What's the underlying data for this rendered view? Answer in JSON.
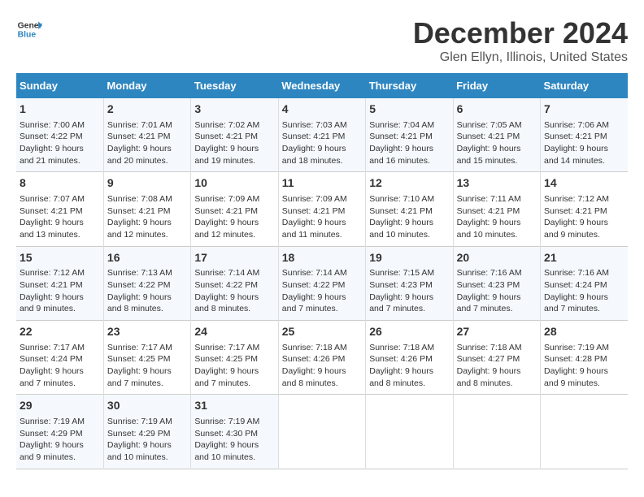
{
  "header": {
    "logo_line1": "General",
    "logo_line2": "Blue",
    "title": "December 2024",
    "subtitle": "Glen Ellyn, Illinois, United States"
  },
  "days_of_week": [
    "Sunday",
    "Monday",
    "Tuesday",
    "Wednesday",
    "Thursday",
    "Friday",
    "Saturday"
  ],
  "weeks": [
    [
      {
        "day": "1",
        "info": "Sunrise: 7:00 AM\nSunset: 4:22 PM\nDaylight: 9 hours\nand 21 minutes."
      },
      {
        "day": "2",
        "info": "Sunrise: 7:01 AM\nSunset: 4:21 PM\nDaylight: 9 hours\nand 20 minutes."
      },
      {
        "day": "3",
        "info": "Sunrise: 7:02 AM\nSunset: 4:21 PM\nDaylight: 9 hours\nand 19 minutes."
      },
      {
        "day": "4",
        "info": "Sunrise: 7:03 AM\nSunset: 4:21 PM\nDaylight: 9 hours\nand 18 minutes."
      },
      {
        "day": "5",
        "info": "Sunrise: 7:04 AM\nSunset: 4:21 PM\nDaylight: 9 hours\nand 16 minutes."
      },
      {
        "day": "6",
        "info": "Sunrise: 7:05 AM\nSunset: 4:21 PM\nDaylight: 9 hours\nand 15 minutes."
      },
      {
        "day": "7",
        "info": "Sunrise: 7:06 AM\nSunset: 4:21 PM\nDaylight: 9 hours\nand 14 minutes."
      }
    ],
    [
      {
        "day": "8",
        "info": "Sunrise: 7:07 AM\nSunset: 4:21 PM\nDaylight: 9 hours\nand 13 minutes."
      },
      {
        "day": "9",
        "info": "Sunrise: 7:08 AM\nSunset: 4:21 PM\nDaylight: 9 hours\nand 12 minutes."
      },
      {
        "day": "10",
        "info": "Sunrise: 7:09 AM\nSunset: 4:21 PM\nDaylight: 9 hours\nand 12 minutes."
      },
      {
        "day": "11",
        "info": "Sunrise: 7:09 AM\nSunset: 4:21 PM\nDaylight: 9 hours\nand 11 minutes."
      },
      {
        "day": "12",
        "info": "Sunrise: 7:10 AM\nSunset: 4:21 PM\nDaylight: 9 hours\nand 10 minutes."
      },
      {
        "day": "13",
        "info": "Sunrise: 7:11 AM\nSunset: 4:21 PM\nDaylight: 9 hours\nand 10 minutes."
      },
      {
        "day": "14",
        "info": "Sunrise: 7:12 AM\nSunset: 4:21 PM\nDaylight: 9 hours\nand 9 minutes."
      }
    ],
    [
      {
        "day": "15",
        "info": "Sunrise: 7:12 AM\nSunset: 4:21 PM\nDaylight: 9 hours\nand 9 minutes."
      },
      {
        "day": "16",
        "info": "Sunrise: 7:13 AM\nSunset: 4:22 PM\nDaylight: 9 hours\nand 8 minutes."
      },
      {
        "day": "17",
        "info": "Sunrise: 7:14 AM\nSunset: 4:22 PM\nDaylight: 9 hours\nand 8 minutes."
      },
      {
        "day": "18",
        "info": "Sunrise: 7:14 AM\nSunset: 4:22 PM\nDaylight: 9 hours\nand 7 minutes."
      },
      {
        "day": "19",
        "info": "Sunrise: 7:15 AM\nSunset: 4:23 PM\nDaylight: 9 hours\nand 7 minutes."
      },
      {
        "day": "20",
        "info": "Sunrise: 7:16 AM\nSunset: 4:23 PM\nDaylight: 9 hours\nand 7 minutes."
      },
      {
        "day": "21",
        "info": "Sunrise: 7:16 AM\nSunset: 4:24 PM\nDaylight: 9 hours\nand 7 minutes."
      }
    ],
    [
      {
        "day": "22",
        "info": "Sunrise: 7:17 AM\nSunset: 4:24 PM\nDaylight: 9 hours\nand 7 minutes."
      },
      {
        "day": "23",
        "info": "Sunrise: 7:17 AM\nSunset: 4:25 PM\nDaylight: 9 hours\nand 7 minutes."
      },
      {
        "day": "24",
        "info": "Sunrise: 7:17 AM\nSunset: 4:25 PM\nDaylight: 9 hours\nand 7 minutes."
      },
      {
        "day": "25",
        "info": "Sunrise: 7:18 AM\nSunset: 4:26 PM\nDaylight: 9 hours\nand 8 minutes."
      },
      {
        "day": "26",
        "info": "Sunrise: 7:18 AM\nSunset: 4:26 PM\nDaylight: 9 hours\nand 8 minutes."
      },
      {
        "day": "27",
        "info": "Sunrise: 7:18 AM\nSunset: 4:27 PM\nDaylight: 9 hours\nand 8 minutes."
      },
      {
        "day": "28",
        "info": "Sunrise: 7:19 AM\nSunset: 4:28 PM\nDaylight: 9 hours\nand 9 minutes."
      }
    ],
    [
      {
        "day": "29",
        "info": "Sunrise: 7:19 AM\nSunset: 4:29 PM\nDaylight: 9 hours\nand 9 minutes."
      },
      {
        "day": "30",
        "info": "Sunrise: 7:19 AM\nSunset: 4:29 PM\nDaylight: 9 hours\nand 10 minutes."
      },
      {
        "day": "31",
        "info": "Sunrise: 7:19 AM\nSunset: 4:30 PM\nDaylight: 9 hours\nand 10 minutes."
      },
      null,
      null,
      null,
      null
    ]
  ]
}
